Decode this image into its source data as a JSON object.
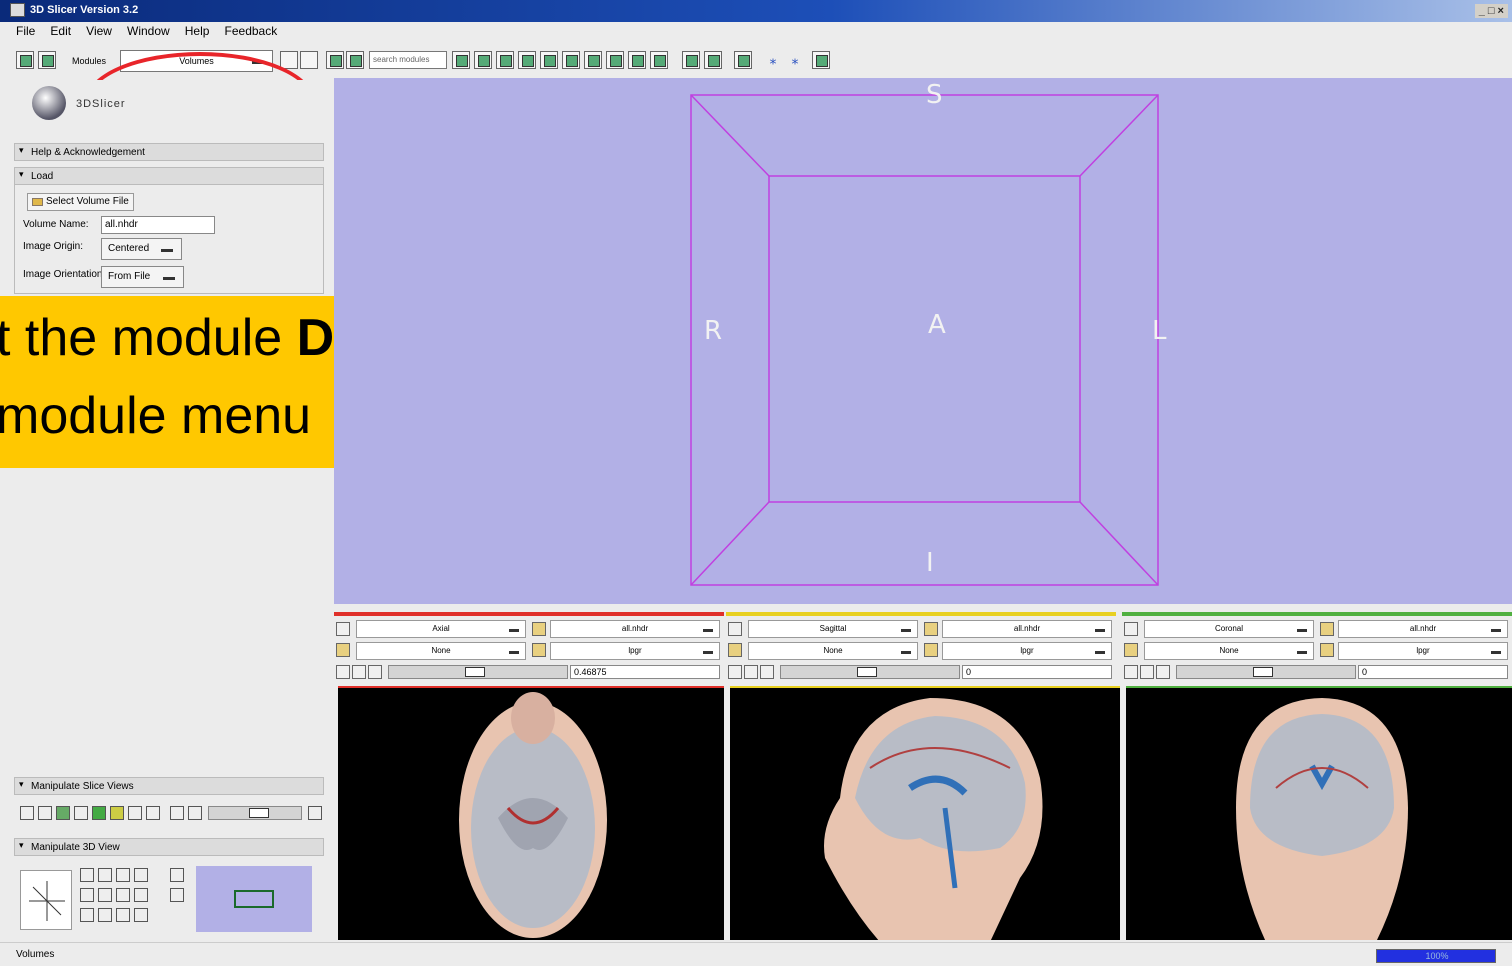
{
  "window": {
    "title": "3D Slicer Version 3.2",
    "buttons": "_ □ ×"
  },
  "menu": [
    "File",
    "Edit",
    "View",
    "Window",
    "Help",
    "Feedback"
  ],
  "toolbar": {
    "modules_label": "Modules",
    "module_selected": "Volumes",
    "search_placeholder": "search modules"
  },
  "logo_text": "3DSlicer",
  "panel": {
    "help_section": "Help & Acknowledgement",
    "load_section": "Load",
    "select_volume_button": "Select Volume File",
    "volume_name_label": "Volume Name:",
    "volume_name_value": "all.nhdr",
    "image_origin_label": "Image Origin:",
    "image_origin_value": "Centered",
    "image_orientation_label": "Image Orientation",
    "image_orientation_value": "From File",
    "manipulate_slice_section": "Manipulate Slice Views",
    "manipulate_3d_section": "Manipulate 3D View"
  },
  "banner": {
    "line1_pre": "t the module ",
    "line1_bold": "Data",
    "line2": " module menu"
  },
  "view3d": {
    "labels": {
      "S": "S",
      "R": "R",
      "A": "A",
      "L": "L",
      "I": "I"
    },
    "background": "#b2b0e6",
    "box_color": "#c040e0"
  },
  "slices": [
    {
      "name": "Axial",
      "fg": "None",
      "bg": "all.nhdr",
      "label": "lpgr",
      "offset": "0.46875",
      "color": "#e0302a"
    },
    {
      "name": "Sagittal",
      "fg": "None",
      "bg": "all.nhdr",
      "label": "lpgr",
      "offset": "0",
      "color": "#e8d020"
    },
    {
      "name": "Coronal",
      "fg": "None",
      "bg": "all.nhdr",
      "label": "lpgr",
      "offset": "0",
      "color": "#50b040"
    }
  ],
  "status": {
    "text": "Volumes",
    "progress_text": "100%",
    "progress": 1.0
  }
}
